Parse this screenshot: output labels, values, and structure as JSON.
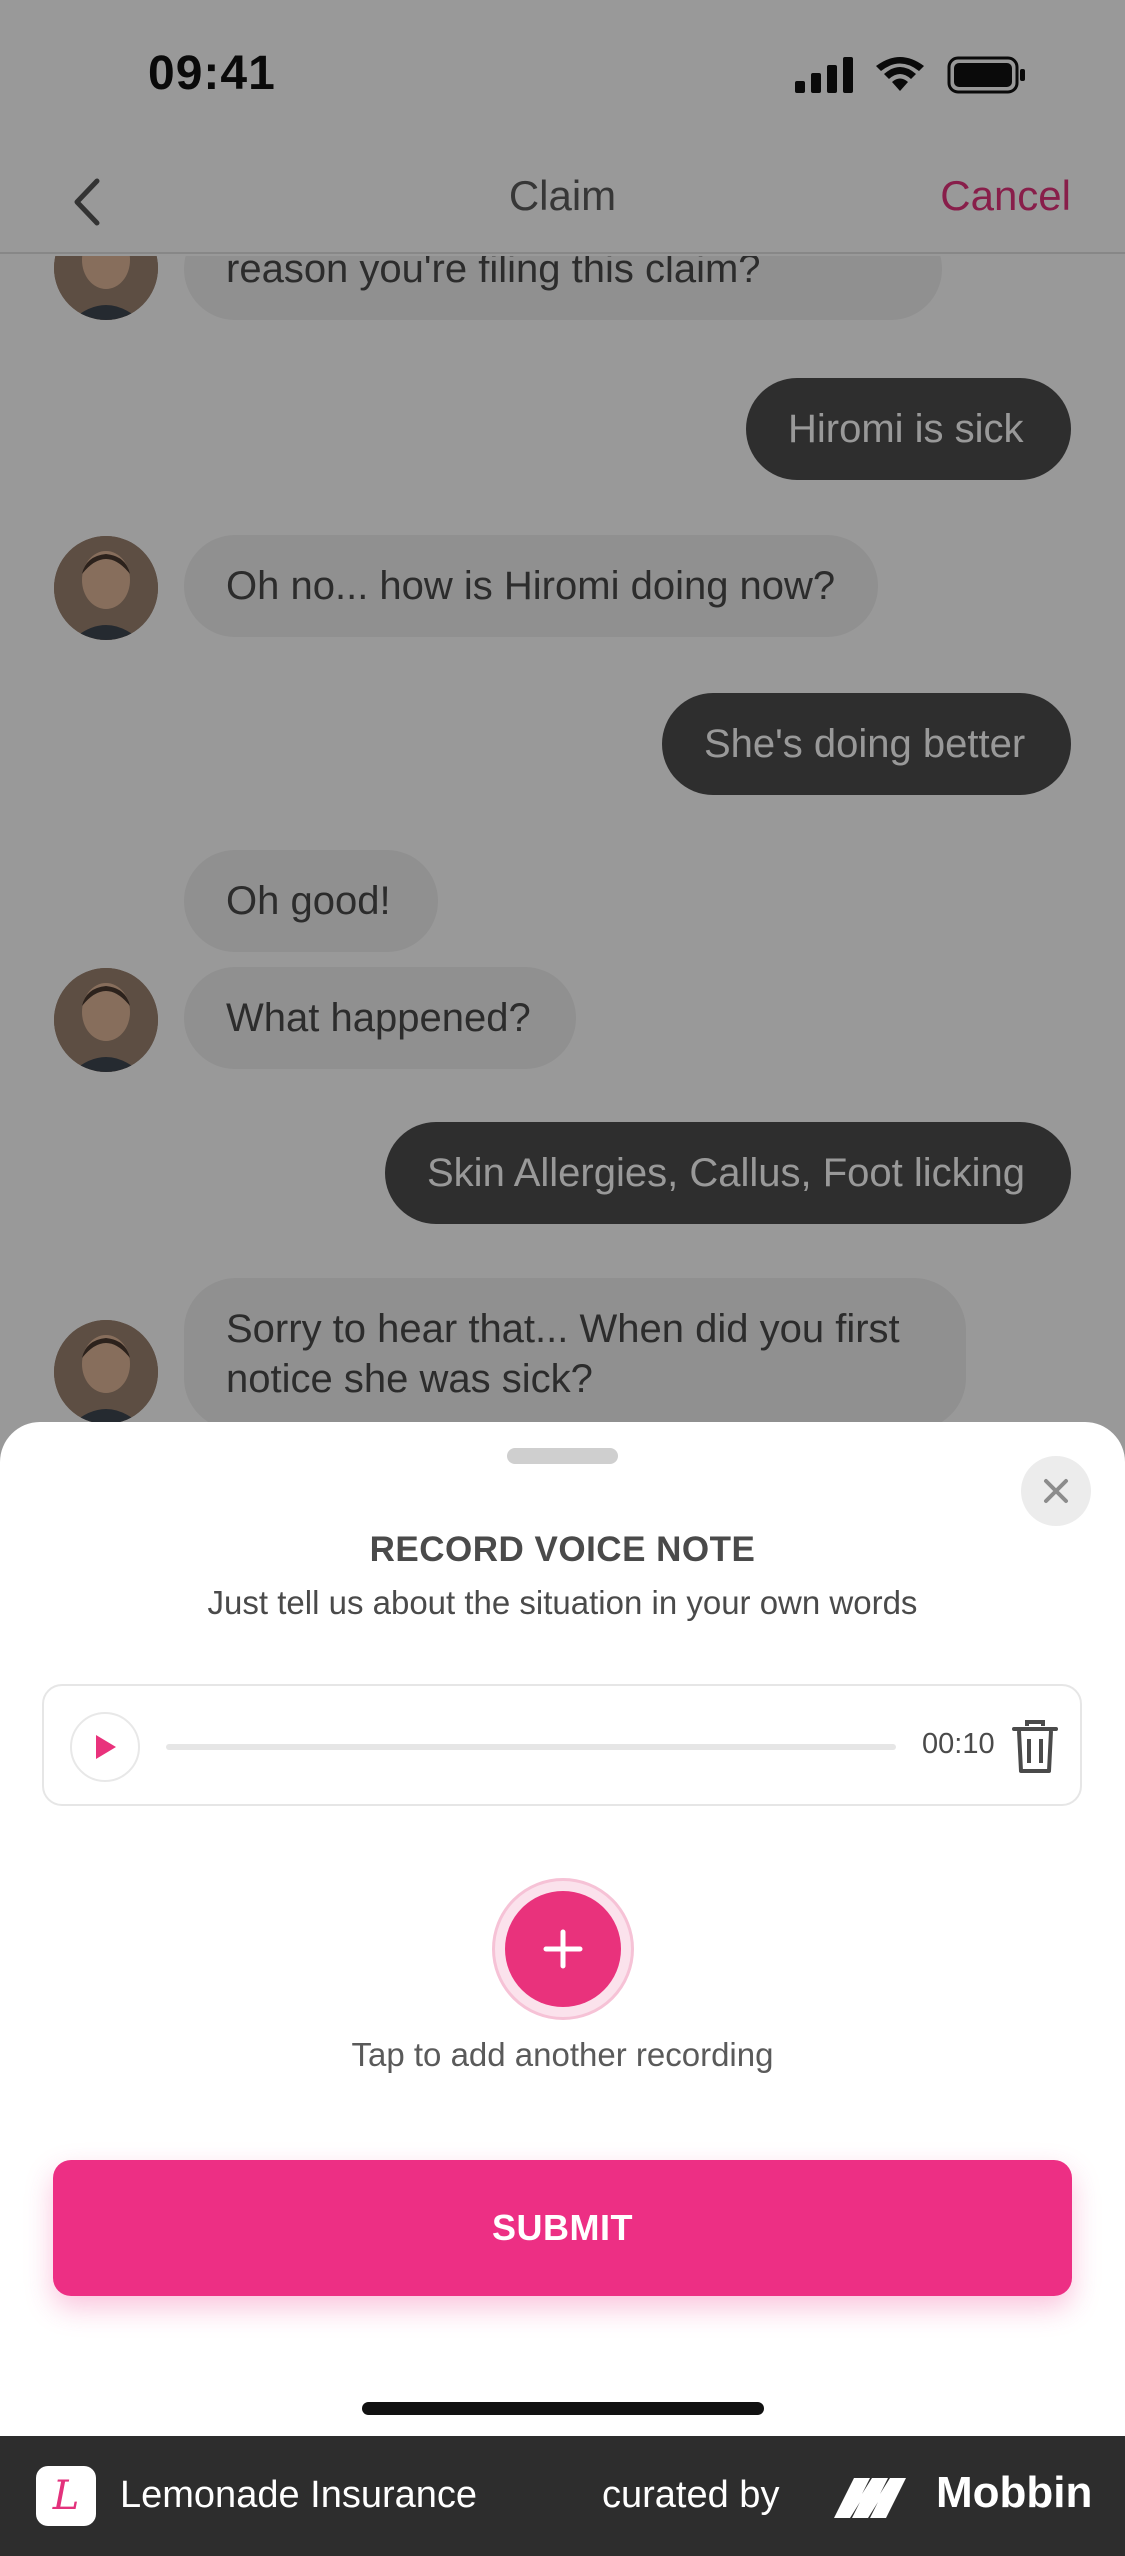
{
  "status_bar": {
    "time": "09:41"
  },
  "nav": {
    "title": "Claim",
    "cancel_label": "Cancel"
  },
  "chat": {
    "messages": [
      {
        "sender": "bot",
        "text": "reason you're filing this claim?"
      },
      {
        "sender": "user",
        "text": "Hiromi is sick"
      },
      {
        "sender": "bot",
        "text": "Oh no... how is Hiromi doing now?"
      },
      {
        "sender": "user",
        "text": "She's doing better"
      },
      {
        "sender": "bot",
        "text": "Oh good!"
      },
      {
        "sender": "bot",
        "text": "What happened?"
      },
      {
        "sender": "user",
        "text": "Skin Allergies, Callus, Foot licking"
      },
      {
        "sender": "bot",
        "text": "Sorry to hear that... When did you first notice she was sick?"
      }
    ]
  },
  "voice_note": {
    "title": "RECORD VOICE NOTE",
    "subtitle": "Just tell us about the situation in your own words",
    "recording": {
      "duration": "00:10",
      "progress": 0
    },
    "add_hint": "Tap to add another recording",
    "submit_label": "SUBMIT"
  },
  "footer": {
    "app_name": "Lemonade Insurance",
    "app_icon_letter": "L",
    "curated_label": "curated by",
    "brand": "Mobbin"
  },
  "colors": {
    "accent": "#ED2F84",
    "user_bubble": "#4D4D4D",
    "bot_bubble": "#F0F0F0"
  }
}
